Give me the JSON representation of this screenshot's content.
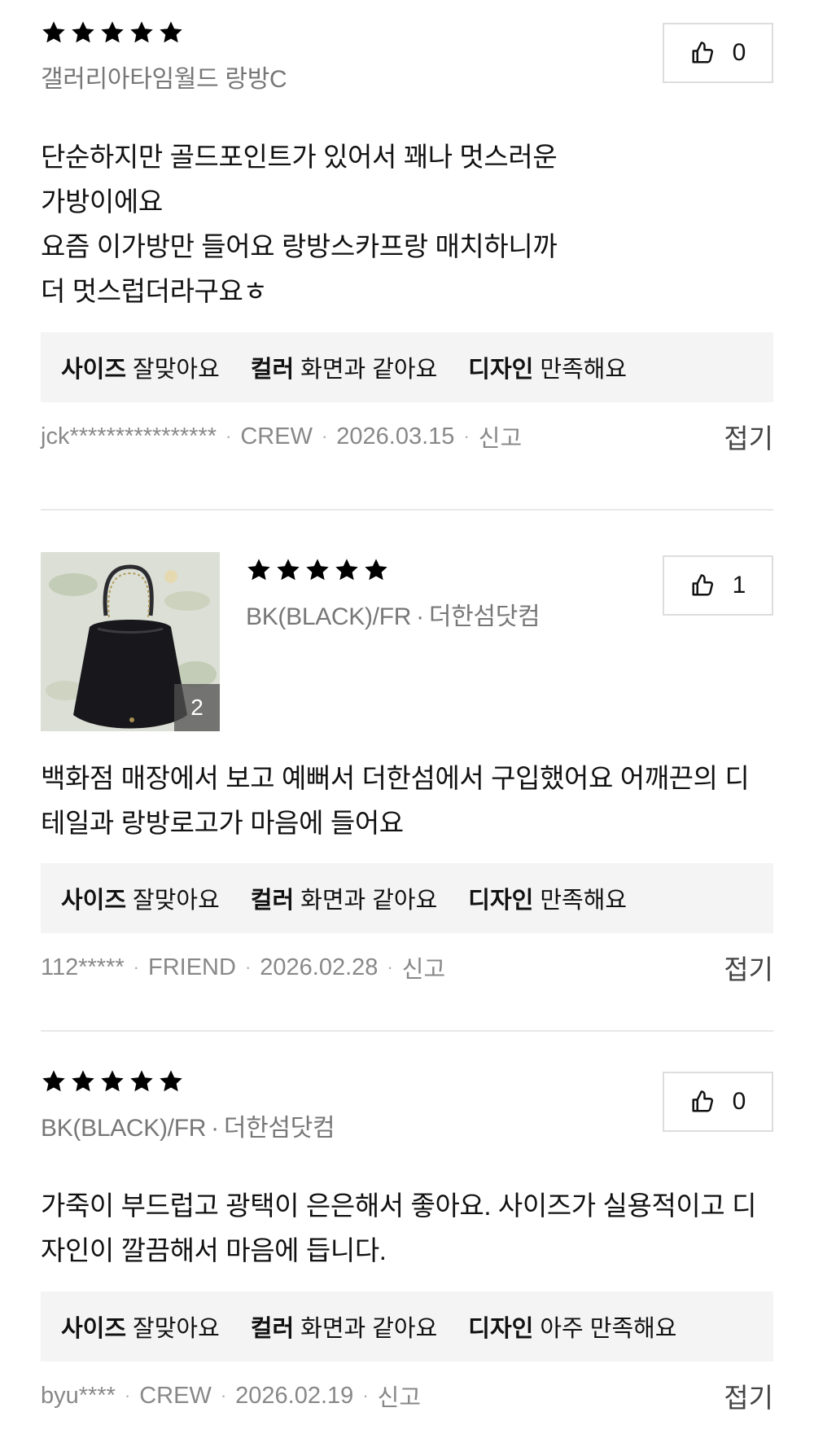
{
  "reviews": [
    {
      "rating": 5,
      "option": "갤러리아타임월드 랑방C",
      "likes": "0",
      "text": "단순하지만 골드포인트가 있어서 꽤나 멋스러운\n가방이에요\n요즘 이가방만 들어요 랑방스카프랑 매치하니까\n더 멋스럽더라구요ㅎ",
      "attributes": [
        {
          "key": "사이즈",
          "value": "잘맞아요"
        },
        {
          "key": "컬러",
          "value": "화면과 같아요"
        },
        {
          "key": "디자인",
          "value": "만족해요"
        }
      ],
      "user": "jck****************",
      "grade": "CREW",
      "date": "2026.03.15",
      "report": "신고",
      "fold": "접기"
    },
    {
      "rating": 5,
      "option": "BK(BLACK)/FR",
      "store": "더한섬닷컴",
      "likes": "1",
      "image_count": "2",
      "text": "백화점 매장에서 보고 예뻐서 더한섬에서 구입했어요 어깨끈의 디\n테일과 랑방로고가 마음에 들어요",
      "attributes": [
        {
          "key": "사이즈",
          "value": "잘맞아요"
        },
        {
          "key": "컬러",
          "value": "화면과 같아요"
        },
        {
          "key": "디자인",
          "value": "만족해요"
        }
      ],
      "user": "112*****",
      "grade": "FRIEND",
      "date": "2026.02.28",
      "report": "신고",
      "fold": "접기"
    },
    {
      "rating": 5,
      "option": "BK(BLACK)/FR",
      "store": "더한섬닷컴",
      "likes": "0",
      "text": "가죽이 부드럽고 광택이 은은해서 좋아요. 사이즈가 실용적이고 디\n자인이 깔끔해서 마음에 듭니다.",
      "attributes": [
        {
          "key": "사이즈",
          "value": "잘맞아요"
        },
        {
          "key": "컬러",
          "value": "화면과 같아요"
        },
        {
          "key": "디자인",
          "value": "아주 만족해요"
        }
      ],
      "user": "byu****",
      "grade": "CREW",
      "date": "2026.02.19",
      "report": "신고",
      "fold": "접기"
    }
  ],
  "icons": {
    "star": "star-icon",
    "like": "thumbs-up-icon"
  }
}
